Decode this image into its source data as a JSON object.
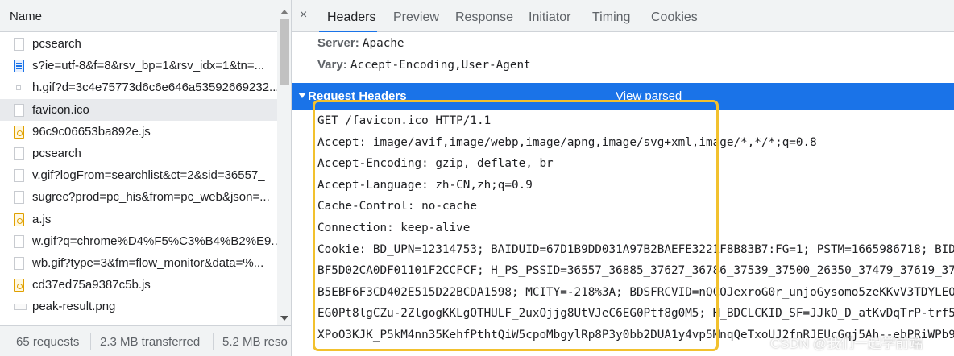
{
  "left_panel": {
    "header_title": "Name",
    "requests": [
      {
        "name": "pcsearch",
        "icon": "document-icon",
        "selected": false
      },
      {
        "name": "s?ie=utf-8&f=8&rsv_bp=1&rsv_idx=1&tn=...",
        "icon": "xhr-icon",
        "selected": false
      },
      {
        "name": "h.gif?d=3c4e75773d6c6e646a53592669232...",
        "icon": "small-image-icon",
        "selected": false
      },
      {
        "name": "favicon.ico",
        "icon": "document-icon",
        "selected": true
      },
      {
        "name": "96c9c06653ba892e.js",
        "icon": "script-icon",
        "selected": false
      },
      {
        "name": "pcsearch",
        "icon": "document-icon",
        "selected": false
      },
      {
        "name": "v.gif?logFrom=searchlist&ct=2&sid=36557_",
        "icon": "document-icon",
        "selected": false
      },
      {
        "name": "sugrec?prod=pc_his&from=pc_web&json=...",
        "icon": "document-icon",
        "selected": false
      },
      {
        "name": "a.js",
        "icon": "script-icon",
        "selected": false
      },
      {
        "name": "w.gif?q=chrome%D4%F5%C3%B4%B2%E9...",
        "icon": "document-icon",
        "selected": false
      },
      {
        "name": "wb.gif?type=3&fm=flow_monitor&data=%...",
        "icon": "document-icon",
        "selected": false
      },
      {
        "name": "cd37ed75a9387c5b.js",
        "icon": "script-icon",
        "selected": false
      },
      {
        "name": "peak-result.png",
        "icon": "image-icon",
        "selected": false
      }
    ],
    "footer": {
      "requests": "65 requests",
      "transferred": "2.3 MB transferred",
      "resources": "5.2 MB reso"
    }
  },
  "right_panel": {
    "close_symbol": "×",
    "tabs": [
      "Headers",
      "Preview",
      "Response",
      "Initiator",
      "Timing",
      "Cookies"
    ],
    "active_tab": "Headers",
    "response_headers": [
      {
        "key": "Server:",
        "value": "Apache"
      },
      {
        "key": "Vary:",
        "value": "Accept-Encoding,User-Agent"
      }
    ],
    "request_section": {
      "title": "Request Headers",
      "view_parsed": "View parsed"
    },
    "request_lines": [
      "GET /favicon.ico HTTP/1.1",
      "Accept: image/avif,image/webp,image/apng,image/svg+xml,image/*,*/*;q=0.8",
      "Accept-Encoding: gzip, deflate, br",
      "Accept-Language: zh-CN,zh;q=0.9",
      "Cache-Control: no-cache",
      "Connection: keep-alive",
      "Cookie: BD_UPN=12314753; BAIDUID=67D1B9DD031A97B2BAEFE3221F8B83B7:FG=1; PSTM=1665986718; BID",
      "BF5D02CA0DF01101F2CCFCF; H_PS_PSSID=36557_36885_37627_36786_37539_37500_26350_37479_37619_37",
      "B5EBF6F3CD402E515D22BCDA1598; MCITY=-218%3A; BDSFRCVID=nQCOJexroG0r_unjoGysomo5zeKKvV3TDYLEO",
      "EG0Pt8lgCZu-2ZlgogKKLgOTHULF_2uxOjjg8UtVJeC6EG0Ptf8g0M5; H_BDCLCKID_SF=JJkO_D_atKvDqTrP-trf5",
      "XPoO3KJK_P5kM4nn35KehfPthtQiW5cpoMbgylRp8P3y0bb2DUA1y4vp5MnqQeTxoUJ2fnRJEUcGqj5Ah--ebPRiWPb9"
    ],
    "watermark": "CSDN @我们一起学前端"
  },
  "colors": {
    "accent": "#1a73e8",
    "highlight_box": "#f2c12e",
    "selected_row": "#e8eaed",
    "toolbar_bg": "#f1f3f4"
  }
}
